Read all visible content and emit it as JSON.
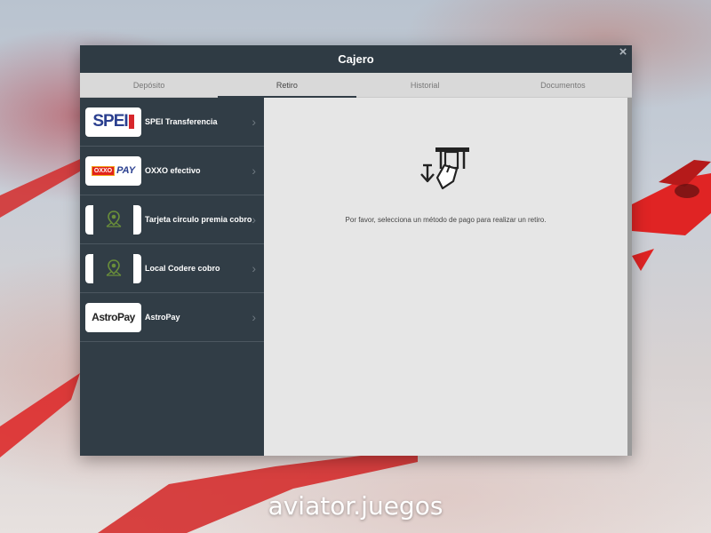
{
  "cashier": {
    "title": "Cajero",
    "close_symbol": "×",
    "tabs": [
      {
        "label": "Depósito",
        "active": false
      },
      {
        "label": "Retiro",
        "active": true
      },
      {
        "label": "Historial",
        "active": false
      },
      {
        "label": "Documentos",
        "active": false
      }
    ],
    "methods": [
      {
        "label": "SPEI Transferencia",
        "logo": "spei-logo",
        "logo_text": "SPEI"
      },
      {
        "label": "OXXO efectivo",
        "logo": "oxxo-pay-logo",
        "logo_text": "OXXO",
        "logo_text_2": "PAY"
      },
      {
        "label": "Tarjeta circulo premia cobro",
        "logo": "map-pin-icon"
      },
      {
        "label": "Local Codere cobro",
        "logo": "map-pin-icon"
      },
      {
        "label": "AstroPay",
        "logo": "astropay-logo",
        "logo_text": "AstroPay"
      }
    ],
    "chevron": "›",
    "main_icon": "atm-withdraw-icon",
    "message": "Por favor, selecciona un método de pago para realizar un retiro."
  },
  "watermark": "aviator.juegos",
  "colors": {
    "panel": "#313d46",
    "tab_bar": "#d9d9d9",
    "main_bg": "#e6e6e6",
    "spei_blue": "#2a3f8f",
    "spei_red": "#d7262b",
    "oxxo_red": "#e2231a",
    "pin_green": "#6a8f3a"
  }
}
